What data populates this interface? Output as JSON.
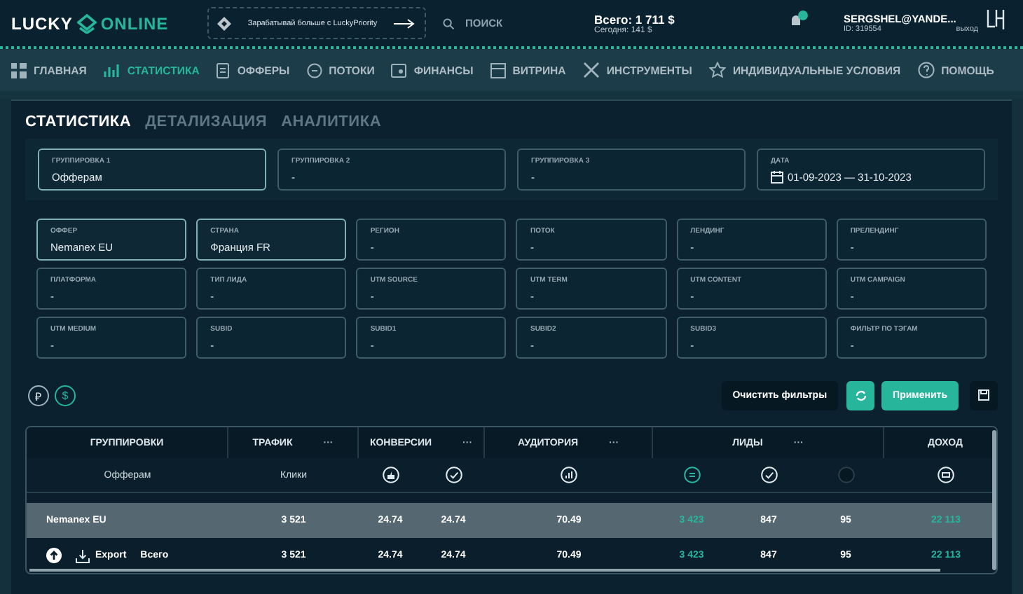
{
  "header": {
    "logo_left": "LUCKY",
    "logo_right": "ONLINE",
    "promo": "Зарабатывай больше с LuckyPriority",
    "search": {
      "placeholder": "ПОИСК"
    },
    "balance_total": "Всего: 1 711 $",
    "balance_today": "Сегодня: 141 $",
    "user_email": "SERGSHEL@YANDE...",
    "user_id": "ID: 319554",
    "logout": "выход"
  },
  "nav": [
    {
      "label": "ГЛАВНАЯ",
      "selected": false
    },
    {
      "label": "СТАТИСТИКА",
      "selected": true
    },
    {
      "label": "ОФФЕРЫ",
      "selected": false
    },
    {
      "label": "ПОТОКИ",
      "selected": false
    },
    {
      "label": "ФИНАНСЫ",
      "selected": false
    },
    {
      "label": "ВИТРИНА",
      "selected": false
    },
    {
      "label": "ИНСТРУМЕНТЫ",
      "selected": false
    },
    {
      "label": "ИНДИВИДУАЛЬНЫЕ УСЛОВИЯ",
      "selected": false
    },
    {
      "label": "ПОМОЩЬ",
      "selected": false
    }
  ],
  "tabs": [
    {
      "label": "СТАТИСТИКА",
      "selected": true
    },
    {
      "label": "ДЕТАЛИЗАЦИЯ",
      "selected": false
    },
    {
      "label": "АНАЛИТИКА",
      "selected": false
    }
  ],
  "groupings": [
    {
      "label": "ГРУППИРОВКА 1",
      "value": "Офферам",
      "kind": "select",
      "selected": true
    },
    {
      "label": "ГРУППИРОВКА 2",
      "value": "-",
      "kind": "select",
      "selected": false
    },
    {
      "label": "ГРУППИРОВКА 3",
      "value": "-",
      "kind": "select",
      "selected": false
    },
    {
      "label": "ДАТА",
      "value": "01-09-2023 — 31-10-2023",
      "kind": "date",
      "selected": false
    }
  ],
  "filters": [
    {
      "label": "ОФФЕР",
      "value": "Nemanex EU",
      "selected": true
    },
    {
      "label": "СТРАНА",
      "value": "Франция FR",
      "selected": true
    },
    {
      "label": "РЕГИОН",
      "value": "-",
      "selected": false
    },
    {
      "label": "ПОТОК",
      "value": "-",
      "selected": false
    },
    {
      "label": "ЛЕНДИНГ",
      "value": "-",
      "selected": false
    },
    {
      "label": "ПРЕЛЕНДИНГ",
      "value": "-",
      "selected": false
    },
    {
      "label": "ПЛАТФОРМА",
      "value": "-",
      "selected": false
    },
    {
      "label": "ТИП ЛИДА",
      "value": "-",
      "selected": false
    },
    {
      "label": "UTM SOURCE",
      "value": "-",
      "selected": false
    },
    {
      "label": "UTM TERM",
      "value": "-",
      "selected": false
    },
    {
      "label": "UTM CONTENT",
      "value": "-",
      "selected": false
    },
    {
      "label": "UTM CAMPAIGN",
      "value": "-",
      "selected": false
    },
    {
      "label": "UTM MEDIUM",
      "value": "-",
      "selected": false
    },
    {
      "label": "SUBID",
      "value": "-",
      "selected": false
    },
    {
      "label": "SUBID1",
      "value": "-",
      "selected": false
    },
    {
      "label": "SUBID2",
      "value": "-",
      "selected": false
    },
    {
      "label": "SUBID3",
      "value": "-",
      "selected": false
    },
    {
      "label": "ФИЛЬТР ПО ТЭГАМ",
      "value": "-",
      "selected": false
    }
  ],
  "currencies": [
    {
      "label": "₽",
      "selected": false
    },
    {
      "label": "$",
      "selected": true
    }
  ],
  "actions": {
    "clear": "Очистить фильтры",
    "apply": "Применить"
  },
  "table": {
    "groups": [
      {
        "title": "ГРУППИРОВКИ",
        "subcolumns": [
          {
            "kind": "label",
            "label": "Офферам"
          }
        ]
      },
      {
        "title": "ТРАФИК",
        "menu": "···",
        "subcolumns": [
          {
            "kind": "label",
            "label": "Клики"
          }
        ]
      },
      {
        "title": "КОНВЕРСИИ",
        "menu": "···",
        "subcolumns": [
          {
            "kind": "thumb"
          },
          {
            "kind": "check"
          }
        ]
      },
      {
        "title": "АУДИТОРИЯ",
        "menu": "···",
        "subcolumns": [
          {
            "kind": "chart"
          }
        ]
      },
      {
        "title": "ЛИДЫ",
        "menu": "···",
        "subcolumns": [
          {
            "kind": "list"
          },
          {
            "kind": "check"
          },
          {
            "kind": "dot"
          }
        ]
      },
      {
        "title": "ДОХОД",
        "subcolumns": [
          {
            "kind": "money"
          }
        ]
      }
    ],
    "rows": [
      {
        "kind": "data",
        "selected": true,
        "cells": [
          {
            "text": "Nemanex EU",
            "accent": false
          },
          {
            "text": "3 521",
            "accent": false
          },
          {
            "text": "24.74",
            "accent": false
          },
          {
            "text": "24.74",
            "accent": false
          },
          {
            "text": "70.49",
            "accent": false
          },
          {
            "text": "3 423",
            "accent": true
          },
          {
            "text": "847",
            "accent": false
          },
          {
            "text": "95",
            "accent": false
          },
          {
            "text": "22 113",
            "accent": true
          }
        ]
      },
      {
        "kind": "total",
        "selected": false,
        "export": "Export",
        "cells": [
          {
            "text": "Всего",
            "accent": false
          },
          {
            "text": "3 521",
            "accent": false
          },
          {
            "text": "24.74",
            "accent": false
          },
          {
            "text": "24.74",
            "accent": false
          },
          {
            "text": "70.49",
            "accent": false
          },
          {
            "text": "3 423",
            "accent": true
          },
          {
            "text": "847",
            "accent": false
          },
          {
            "text": "95",
            "accent": false
          },
          {
            "text": "22 113",
            "accent": true
          }
        ]
      }
    ]
  }
}
